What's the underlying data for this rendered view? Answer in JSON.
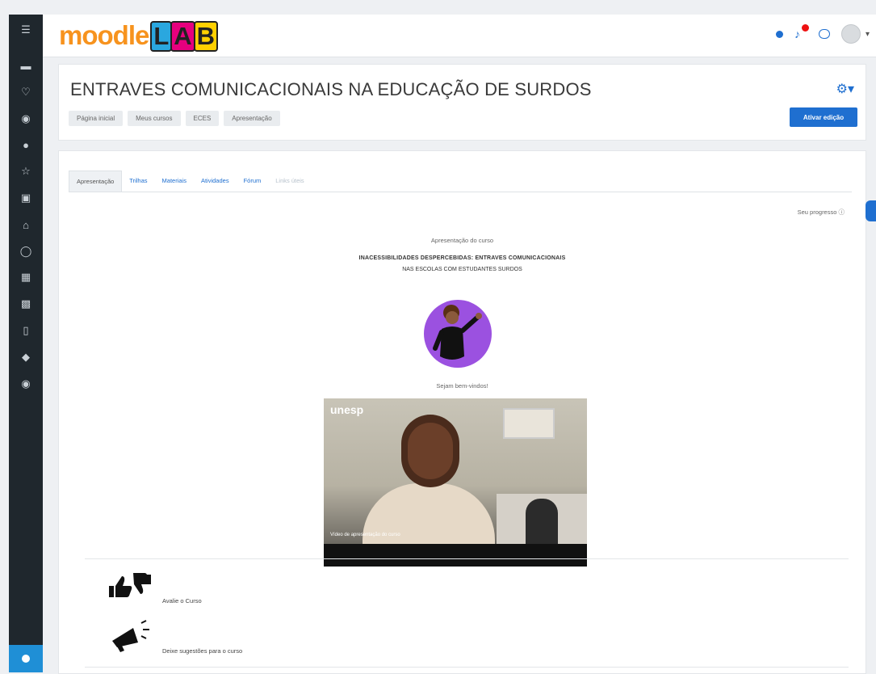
{
  "brand": {
    "logo_moodle": "moodle",
    "logo_lab": [
      "L",
      "A",
      "B"
    ]
  },
  "navbar": {
    "notification_count": ""
  },
  "header": {
    "title": "ENTRAVES COMUNICACIONAIS NA EDUCAÇÃO DE SURDOS",
    "breadcrumb": [
      "Página inicial",
      "Meus cursos",
      "ECES",
      "Apresentação"
    ],
    "edit_button": "Ativar edição"
  },
  "tabs": [
    {
      "label": "Apresentação",
      "state": "active"
    },
    {
      "label": "Trilhas",
      "state": "link"
    },
    {
      "label": "Materiais",
      "state": "link"
    },
    {
      "label": "Atividades",
      "state": "link"
    },
    {
      "label": "Fórum",
      "state": "link"
    },
    {
      "label": "Links úteis",
      "state": "disabled"
    }
  ],
  "content": {
    "progress_label": "Seu progresso",
    "subtitle": "Apresentação do curso",
    "heading_line1": "INACESSIBILIDADES DESPERCEBIDAS: ENTRAVES COMUNICACIONAIS",
    "heading_line2": "NAS ESCOLAS COM ESTUDANTES SURDOS",
    "welcome": "Sejam bem-vindos!",
    "video_brand": "unesp",
    "video_caption": "Vídeo de apresentação do curso",
    "items": [
      {
        "label": "Avalie o Curso",
        "icon": "thumbs-icon"
      },
      {
        "label": "Deixe sugestões para o curso",
        "icon": "megaphone-icon"
      }
    ]
  },
  "colors": {
    "accent": "#1f6fd0",
    "rail": "#1f272d",
    "illustration_bg": "#9b51e0"
  }
}
